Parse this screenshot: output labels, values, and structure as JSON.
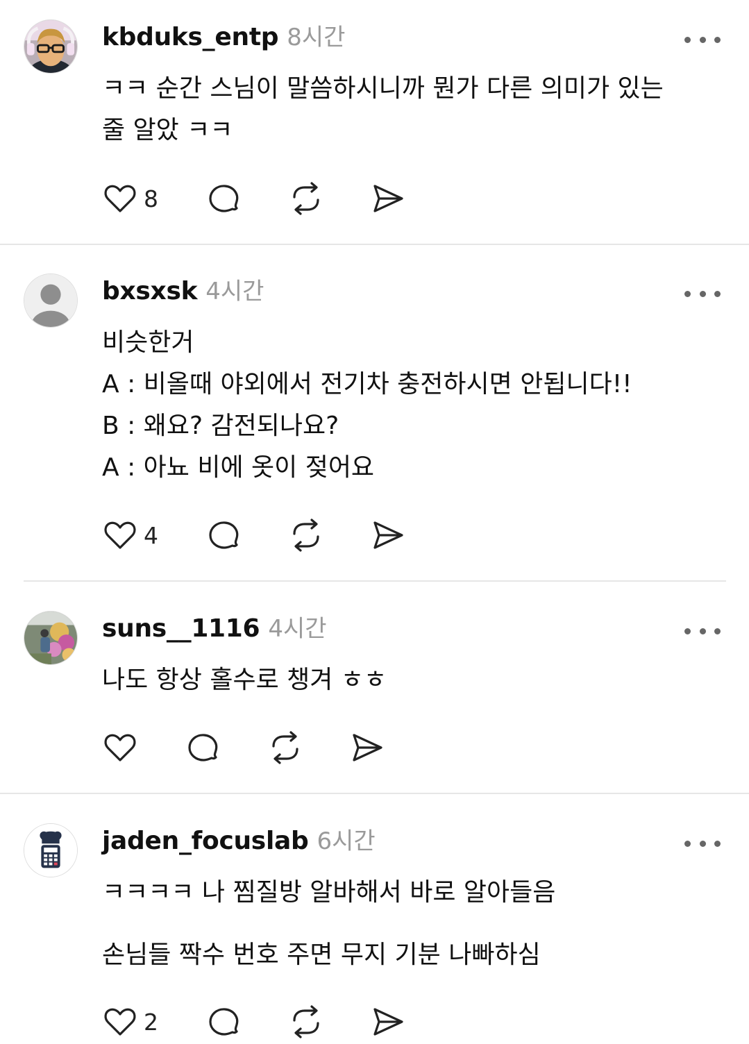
{
  "comments": [
    {
      "username": "kbduks_entp",
      "time": "8시간",
      "lines": [
        "ㅋㅋ 순간 스님이 말씀하시니까 뭔가 다른 의미가 있는",
        "줄 알았 ㅋㅋ"
      ],
      "like_count": "8",
      "avatar": "photo-man-glasses"
    },
    {
      "username": "bxsxsk",
      "time": "4시간",
      "lines": [
        "비슷한거",
        "A : 비올때 야외에서 전기차 충전하시면 안됩니다!!",
        "B : 왜요? 감전되나요?",
        "A : 아뇨 비에 옷이 젖어요"
      ],
      "like_count": "4",
      "avatar": "default-person-icon"
    },
    {
      "username": "suns__1116",
      "time": "4시간",
      "lines": [
        "나도 항상 홀수로 챙겨 ㅎㅎ"
      ],
      "like_count": "",
      "avatar": "photo-flowers"
    },
    {
      "username": "jaden_focuslab",
      "time": "6시간",
      "lines": [
        "ㅋㅋㅋㅋ 나 찜질방 알바해서 바로 알아들음",
        "",
        "손님들 짝수 번호 주면 무지 기분 나빠하심"
      ],
      "like_count": "2",
      "avatar": "calculator-chef-icon"
    }
  ],
  "icons": {
    "like": "heart-icon",
    "comment": "speech-bubble-icon",
    "repost": "repost-icon",
    "share": "send-icon",
    "more": "more-options-icon"
  },
  "colors": {
    "text": "#111111",
    "time": "#9a9a9a",
    "divider": "#e6e6e6",
    "icon": "#222222"
  }
}
